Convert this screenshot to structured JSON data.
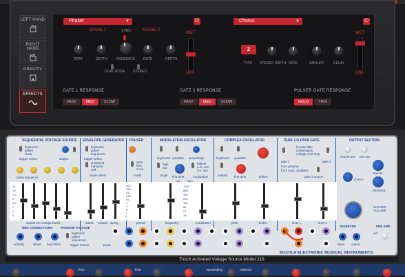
{
  "sidebar": {
    "items": [
      {
        "label": "LEFT HAND",
        "icon": "left-hand-icon",
        "active": false
      },
      {
        "label": "RIGHT HAND",
        "icon": "right-hand-icon",
        "active": false
      },
      {
        "label": "GRAVITY",
        "icon": "gravity-icon",
        "active": false
      },
      {
        "label": "EFFECTS",
        "icon": "wave-icon",
        "active": true
      }
    ]
  },
  "effect1": {
    "type": "Phaser",
    "stage1_label": "STAGE 1",
    "sync_label": "SYNC",
    "stage2_label": "STAGE 2",
    "rate1": "RATE",
    "depth1": "DEPTH",
    "feedback": "FEEDBACK",
    "rate2": "RATE",
    "depth2": "DEPTH",
    "dual_mode": "DUAL MODE",
    "stereo": "STEREO",
    "wet": "WET",
    "dry": "DRY"
  },
  "effect2": {
    "type": "Chorus",
    "type_label": "TYPE",
    "type_value": "2",
    "stereo_width": "STEREO WIDTH",
    "rate": "RATE",
    "amount": "AMOUNT",
    "delay": "DELAY",
    "wet": "WET",
    "dry": "DRY"
  },
  "gates": {
    "gate1": {
      "title": "GATE 1 RESPONSE",
      "fast": "FAST",
      "med": "MED",
      "slow": "SLOW",
      "selected": "MED"
    },
    "gate2": {
      "title": "GATE 2 RESPONSE",
      "fast": "FAST",
      "med": "MED",
      "slow": "SLOW",
      "selected": "MED"
    },
    "pulser": {
      "title": "PULSER GATE RESPONSE",
      "hold": "HOLD",
      "trig": "TRIG",
      "selected": "HOLD"
    }
  },
  "buchla": {
    "modules": {
      "seq": "SEQUENTIAL VOLTAGE SOURCE",
      "env": "ENVELOPE GENERATOR",
      "pulser": "PULSER",
      "modosc": "MODULATION OSCILLATOR",
      "complex": "COMPLEX OSCILLATOR",
      "lpg": "DUAL LO-PASS GATE",
      "output": "OUTPUT SECTION"
    },
    "labels": {
      "keyboard_pulser_clock": "keyboard\npulser\nclock",
      "trigger_select": "trigger select",
      "stages": "stages",
      "pulse_sequence": "pulse sequence",
      "env_keyboard": "keyboard\npulser\nsequencer",
      "env_trigger_select": "trigger select",
      "sustained_transient_self": "sustained\ntransient\nself",
      "mode_select": "mode select",
      "pulser_sync": "sync\nfree\nclock",
      "mode": "mode",
      "modosc_keyboard": "keyboard",
      "quantize": "quantize",
      "waveshape": "waveshape",
      "high_low": "high\nlow",
      "range": "range",
      "fine_tune_mod": "fine tune",
      "modulation_sel": "bal/ext\na.m. osc\nf.m. osc",
      "modulation_lbl": "modulation",
      "complex_keyboard": "keyboard",
      "complex_quantize": "quantize",
      "polarity": "polarity",
      "complex_fine_tune": "fine tune",
      "timbre_knob": "timbre",
      "lpg_to_pass": "lo pass filter\ncombination\nvoltage cntrl amp",
      "gate1": "gate 1",
      "gate2": "gate 2",
      "from_pre": "from preamp",
      "from_mod_osc": "from mod. oscillator",
      "gate3_source": "gate 3 source",
      "mod_in": "mod in out",
      "env_out": "env out",
      "chan_a": "chan A",
      "chan_b": "chan B",
      "reverb": "REVERB",
      "master_volume": "MASTER\nVOLUME",
      "inverter": "INVERTER",
      "pre_amp": "PRE AMP",
      "input": "input",
      "output": "output",
      "gain": "ext",
      "ev_levels": "sequencer voltage levels",
      "attack": "attack",
      "sustain": "sustain",
      "decay": "decay",
      "period": "period",
      "frequency": "frequency",
      "modulation": "modulation",
      "pitch": "pitch",
      "timbre": "timbre",
      "level1": "level 1",
      "level2": "level 2",
      "midi_connections": "MIDI CONNECTIONS",
      "velocity": "velocity",
      "wheel": "wheel",
      "key_follow": "key follow",
      "random_voltage": "RANDOM VOLTAGE",
      "rv_keyboard": "keyboard\npulser\nsequencer",
      "trigger_source": "trigger source",
      "press": "press",
      "low": "low",
      "high": "high"
    },
    "scale_values": [
      "15",
      "10",
      "7.5",
      "5",
      "3.5",
      "2",
      "1",
      "0"
    ],
    "time_values": [
      ".002",
      ".005",
      ".01",
      ".025",
      ".05",
      ".1",
      ".2",
      ".5",
      "1",
      "2",
      "5"
    ],
    "freq_values": [
      "1760",
      "880",
      "440",
      "220",
      "110",
      "55",
      "27",
      "14"
    ],
    "footer": "Touch Activated Voltage Source Model 218",
    "brand": "BUCHLA ELECTRONIC MUSICAL INSTRUMENTS"
  },
  "keybed": {
    "labels": [
      "free",
      "free",
      "ascending",
      "octaves"
    ]
  },
  "colors": {
    "accent_red": "#c7252f",
    "buchla_blue": "#1f57b0",
    "panel_bg": "#dfe3e7"
  }
}
